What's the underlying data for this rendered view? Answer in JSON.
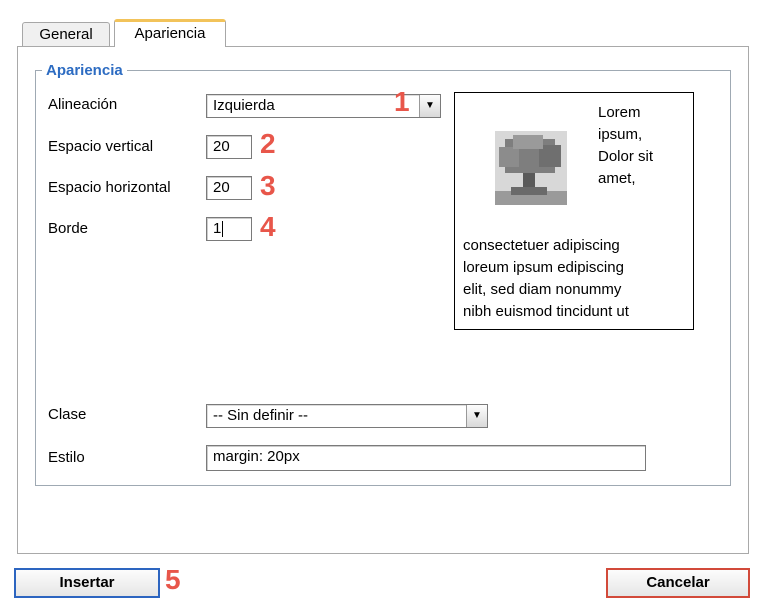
{
  "tabs": {
    "general": "General",
    "apariencia": "Apariencia"
  },
  "fieldset": {
    "legend": "Apariencia"
  },
  "fields": {
    "alineacion": {
      "label": "Alineación",
      "value": "Izquierda",
      "marker": "1"
    },
    "espacio_vertical": {
      "label": "Espacio vertical",
      "value": "20",
      "marker": "2"
    },
    "espacio_horizontal": {
      "label": "Espacio horizontal",
      "value": "20",
      "marker": "3"
    },
    "borde": {
      "label": "Borde",
      "value": "1",
      "marker": "4"
    },
    "clase": {
      "label": "Clase",
      "value": "-- Sin definir --"
    },
    "estilo": {
      "label": "Estilo",
      "value": "margin: 20px"
    }
  },
  "preview": {
    "side_lines": [
      "Lorem",
      "ipsum,",
      "Dolor sit",
      "amet,"
    ],
    "body_lines": [
      "consectetuer adipiscing",
      "loreum ipsum edipiscing",
      "elit, sed diam nonummy",
      "nibh euismod tincidunt ut"
    ]
  },
  "buttons": {
    "insert": "Insertar",
    "insert_marker": "5",
    "cancel": "Cancelar"
  },
  "icons": {
    "select_arrow": "chevron-down-icon",
    "preview_image": "tree-image"
  }
}
